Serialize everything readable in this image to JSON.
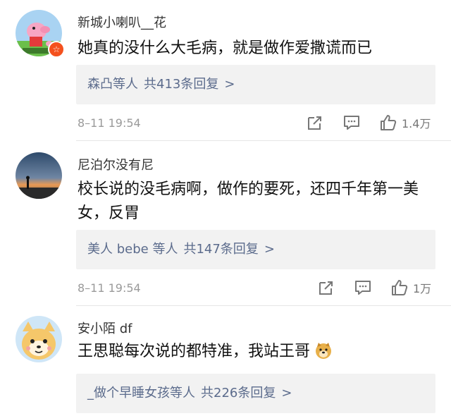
{
  "comments": [
    {
      "username": "新城小喇叭__花",
      "avatar_badge": "☆",
      "avatar": "peppa-pig-avatar",
      "text": "她真的没什么大毛病，就是做作爱撒谎而已",
      "replies": {
        "names": "森凸等人",
        "count_text": "共413条回复",
        "arrow": ">"
      },
      "time": "8–11 19:54",
      "likes": "1.4万"
    },
    {
      "username": "尼泊尔没有尼",
      "avatar": "sunset-silhouette-avatar",
      "text": "校长说的没毛病啊，做作的要死，还四千年第一美女，反胃",
      "replies": {
        "names": "美人 bebe 等人",
        "count_text": "共147条回复",
        "arrow": ">"
      },
      "time": "8–11 19:54",
      "likes": "1万"
    },
    {
      "username": "安小陌 df",
      "avatar": "cartoon-dog-avatar",
      "text": "王思聪每次说的都特准，我站王哥",
      "emoji": "doge-emoji",
      "replies": {
        "names": "_做个早睡女孩等人",
        "count_text": "共226条回复",
        "arrow": ">"
      }
    }
  ],
  "colors": {
    "link": "#5b6b8c",
    "reply_bg": "#f2f2f2",
    "meta": "#9a9a9a",
    "badge": "#f4511e"
  }
}
